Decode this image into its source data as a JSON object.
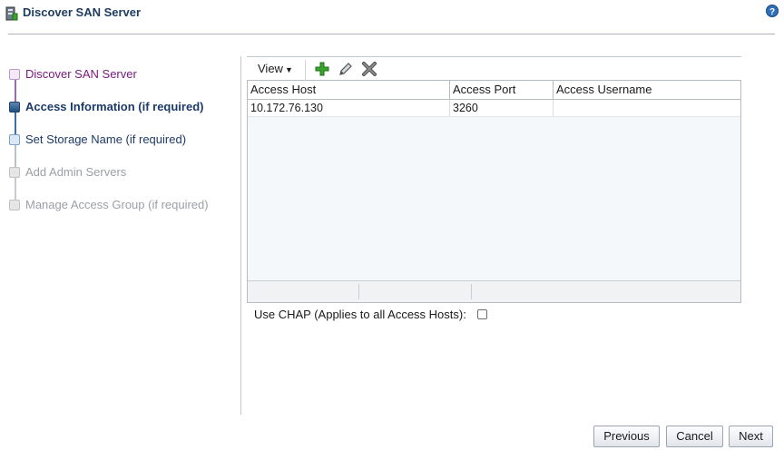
{
  "header": {
    "title": "Discover SAN Server",
    "title_icon": "server-icon",
    "help_icon": "help-icon"
  },
  "train": {
    "steps": [
      {
        "label": "Discover SAN Server",
        "state": "visited"
      },
      {
        "label": "Access Information (if required)",
        "state": "current"
      },
      {
        "label": "Set Storage Name (if required)",
        "state": "next"
      },
      {
        "label": "Add Admin Servers",
        "state": "disabled"
      },
      {
        "label": "Manage Access Group (if required)",
        "state": "disabled"
      }
    ]
  },
  "toolbar": {
    "view_label": "View",
    "add_icon": "add-icon",
    "edit_icon": "edit-icon",
    "delete_icon": "delete-icon"
  },
  "table": {
    "columns": [
      "Access Host",
      "Access Port",
      "Access Username"
    ],
    "rows": [
      [
        "10.172.76.130",
        "3260",
        ""
      ]
    ]
  },
  "chap": {
    "label": "Use CHAP (Applies to all Access Hosts):",
    "checked": false
  },
  "buttons": {
    "previous": "Previous",
    "cancel": "Cancel",
    "next": "Next"
  },
  "colors": {
    "accent": "#1d3a5f",
    "visited": "#7a1a82",
    "add_green": "#3aa52c"
  }
}
